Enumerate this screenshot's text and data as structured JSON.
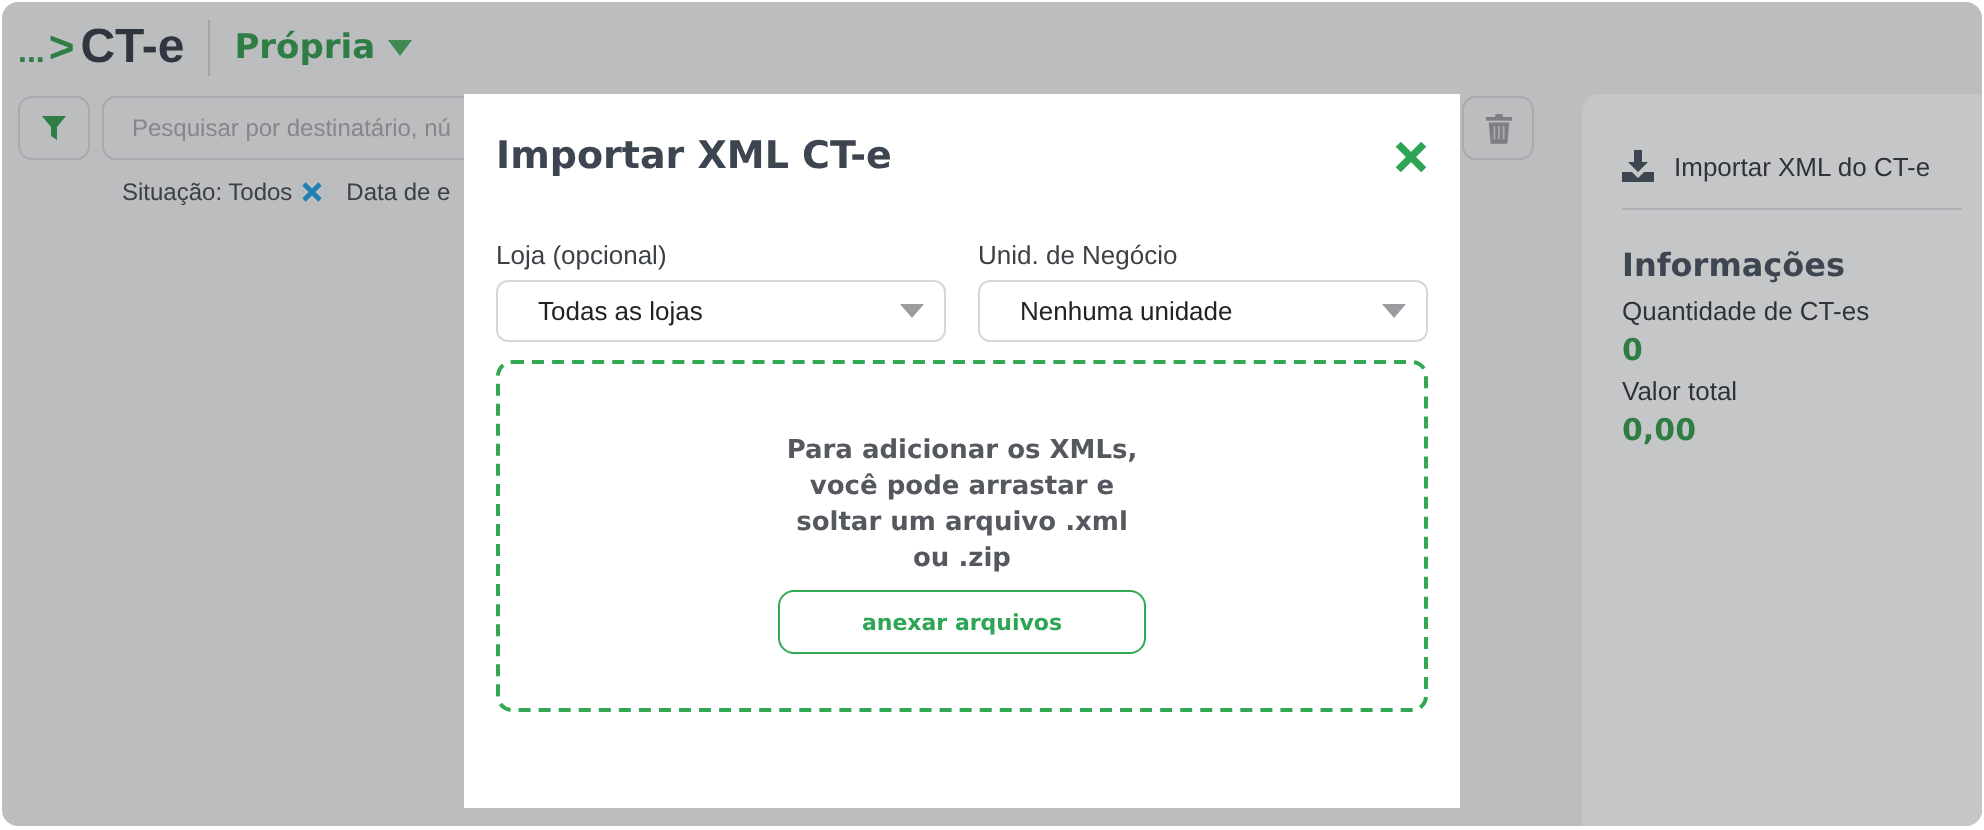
{
  "breadcrumb": {
    "ellipsis": "...",
    "separator": ">",
    "title": "CT-e"
  },
  "type_dropdown": {
    "label": "Própria"
  },
  "search": {
    "placeholder": "Pesquisar por destinatário, nú"
  },
  "filters": [
    {
      "label": "Situação: Todos",
      "removable": true
    },
    {
      "label": "Data de e",
      "removable": false
    }
  ],
  "side_panel": {
    "action": "Importar XML do CT-e",
    "section_title": "Informações",
    "stats": [
      {
        "label": "Quantidade de CT-es",
        "value": "0"
      },
      {
        "label": "Valor total",
        "value": "0,00"
      }
    ]
  },
  "modal": {
    "title": "Importar XML CT-e",
    "fields": [
      {
        "label": "Loja (opcional)",
        "value": "Todas as lojas"
      },
      {
        "label": "Unid. de Negócio",
        "value": "Nenhuma unidade"
      }
    ],
    "dropzone": {
      "text": "Para adicionar os XMLs, você pode arrastar e soltar um arquivo .xml ou .zip",
      "button": "anexar arquivos"
    }
  }
}
